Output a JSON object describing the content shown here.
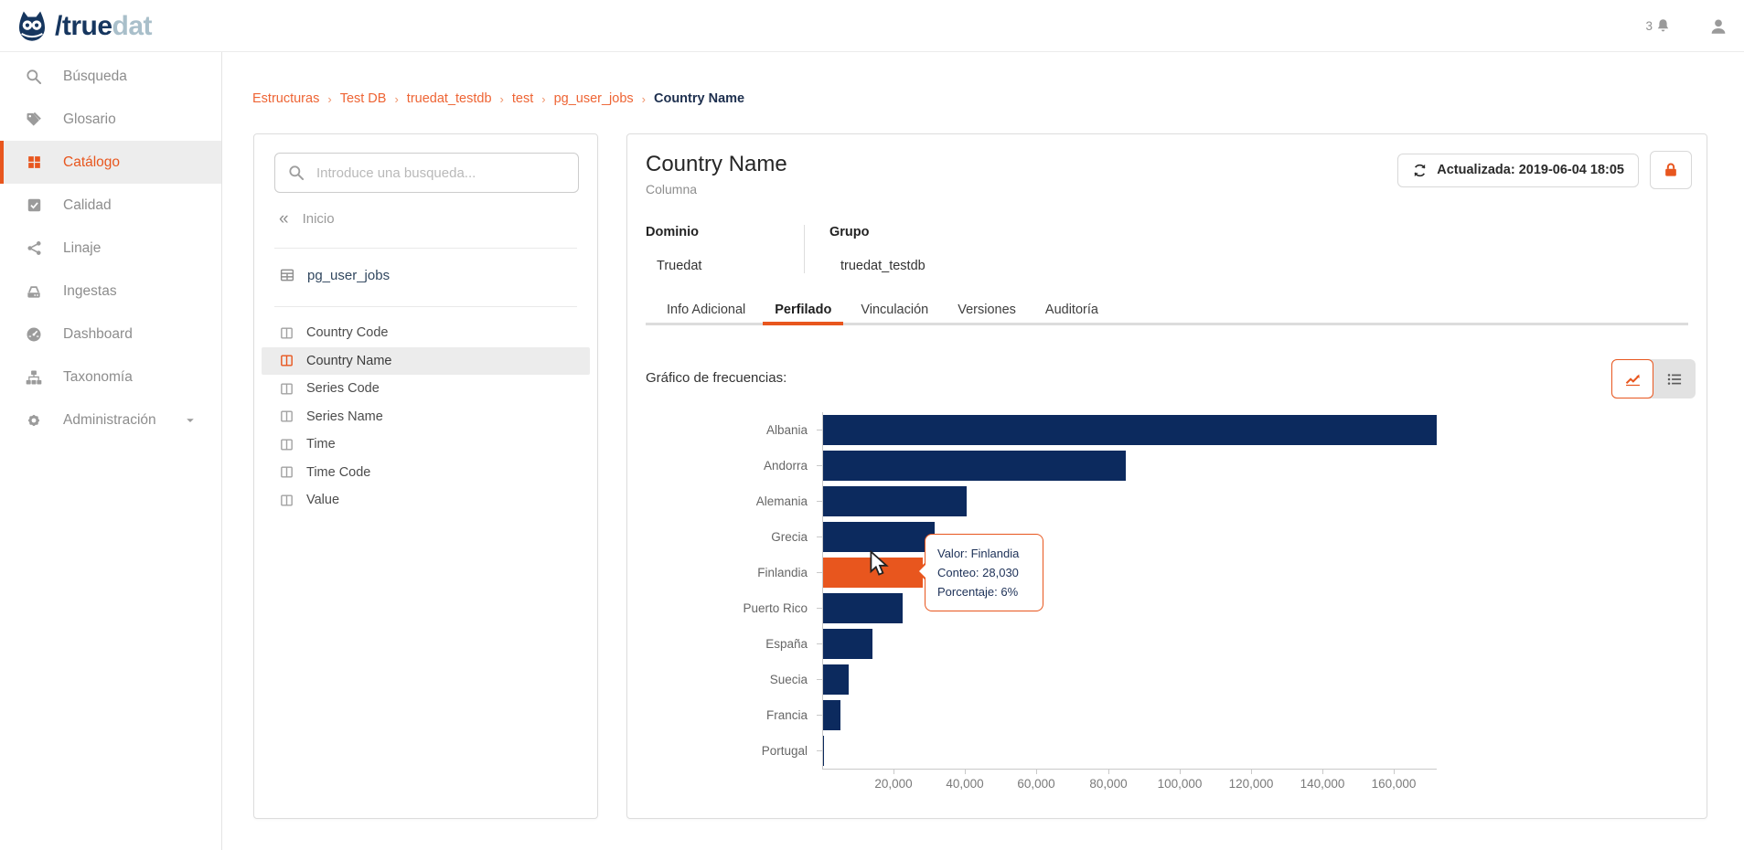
{
  "header": {
    "logo_primary": "/true",
    "logo_secondary": "dat",
    "notification_count": "3"
  },
  "sidebar": {
    "items": [
      {
        "label": "Búsqueda",
        "icon": "search",
        "active": false,
        "caret": false
      },
      {
        "label": "Glosario",
        "icon": "tags",
        "active": false,
        "caret": false
      },
      {
        "label": "Catálogo",
        "icon": "grid",
        "active": true,
        "caret": false
      },
      {
        "label": "Calidad",
        "icon": "check-square",
        "active": false,
        "caret": false
      },
      {
        "label": "Linaje",
        "icon": "share",
        "active": false,
        "caret": false
      },
      {
        "label": "Ingestas",
        "icon": "drive",
        "active": false,
        "caret": false
      },
      {
        "label": "Dashboard",
        "icon": "gauge",
        "active": false,
        "caret": false
      },
      {
        "label": "Taxonomía",
        "icon": "sitemap",
        "active": false,
        "caret": false
      },
      {
        "label": "Administración",
        "icon": "gear",
        "active": false,
        "caret": true
      }
    ]
  },
  "breadcrumb": {
    "links": [
      "Estructuras",
      "Test DB",
      "truedat_testdb",
      "test",
      "pg_user_jobs"
    ],
    "current": "Country Name",
    "separator": "›"
  },
  "explorer": {
    "search_placeholder": "Introduce una busqueda...",
    "back_label": "Inicio",
    "back_chevrons": "«",
    "table_name": "pg_user_jobs",
    "columns": [
      "Country Code",
      "Country Name",
      "Series Code",
      "Series Name",
      "Time",
      "Time Code",
      "Value"
    ],
    "selected_column": "Country Name"
  },
  "detail": {
    "title": "Country Name",
    "subtitle": "Columna",
    "updated_label": "Actualizada: 2019-06-04 18:05",
    "domain": {
      "label": "Dominio",
      "value": "Truedat"
    },
    "group": {
      "label": "Grupo",
      "value": "truedat_testdb"
    },
    "tabs": [
      "Info Adicional",
      "Perfilado",
      "Vinculación",
      "Versiones",
      "Auditoría"
    ],
    "active_tab": "Perfilado",
    "freq_label": "Gráfico de frecuencias:"
  },
  "tooltip": {
    "lines": [
      "Valor: Finlandia",
      "Conteo: 28,030",
      "Porcentaje: 6%"
    ]
  },
  "chart_data": {
    "type": "bar",
    "orientation": "horizontal",
    "title": "Gráfico de frecuencias",
    "categories": [
      "Albania",
      "Andorra",
      "Alemania",
      "Grecia",
      "Finlandia",
      "Puerto Rico",
      "España",
      "Suecia",
      "Francia",
      "Portugal"
    ],
    "values": [
      172000,
      85000,
      40500,
      31500,
      28030,
      22500,
      14000,
      7500,
      5000,
      500
    ],
    "highlight": {
      "category": "Finlandia",
      "value": 28030,
      "count_label": "28,030",
      "percentage": "6%"
    },
    "x_ticks": [
      {
        "value": 20000,
        "label": "20,000"
      },
      {
        "value": 40000,
        "label": "40,000"
      },
      {
        "value": 60000,
        "label": "60,000"
      },
      {
        "value": 80000,
        "label": "80,000"
      },
      {
        "value": 100000,
        "label": "100,000"
      },
      {
        "value": 120000,
        "label": "120,000"
      },
      {
        "value": 140000,
        "label": "140,000"
      },
      {
        "value": 160000,
        "label": "160,000"
      }
    ],
    "xlim": [
      0,
      172000
    ],
    "xlabel": "",
    "ylabel": "",
    "grid": false,
    "legend": false,
    "bar_color": "#0c2a5e",
    "highlight_color": "#e8561e"
  },
  "colors": {
    "accent": "#e8561e",
    "navy": "#0c2a5e",
    "logo_navy": "#16365f",
    "logo_light": "#a9bfca"
  }
}
